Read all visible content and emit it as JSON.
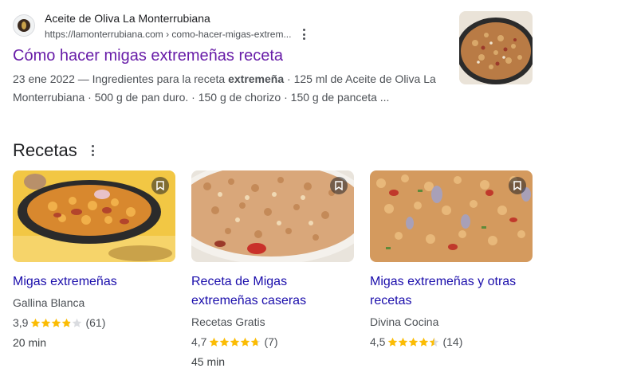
{
  "result": {
    "site_name": "Aceite de Oliva La Monterrubiana",
    "url": "https://lamonterrubiana.com › como-hacer-migas-extrem...",
    "title": "Cómo hacer migas extremeñas receta",
    "snippet_pre": "23 ene 2022 — Ingredientes para la receta ",
    "snippet_bold": "extremeña",
    "snippet_post": " · 125 ml de Aceite de Oliva La Monterrubiana · 500 g de pan duro. · 150 g de chorizo · 150 g de panceta ..."
  },
  "recipes": {
    "heading": "Recetas",
    "cards": [
      {
        "title": "Migas extremeñas",
        "source": "Gallina Blanca",
        "rating": "3,9",
        "rating_value": 3.9,
        "count": "(61)",
        "time": "20 min",
        "image": "pan-of-migas-photo"
      },
      {
        "title": "Receta de Migas extremeñas caseras",
        "source": "Recetas Gratis",
        "rating": "4,7",
        "rating_value": 4.7,
        "count": "(7)",
        "time": "45 min",
        "image": "plate-of-migas-photo"
      },
      {
        "title": "Migas extremeñas y otras recetas",
        "source": "Divina Cocina",
        "rating": "4,5",
        "rating_value": 4.5,
        "count": "(14)",
        "time": "",
        "image": "migas-closeup-photo"
      }
    ]
  },
  "colors": {
    "link_visited": "#681da8",
    "link": "#1a0dab",
    "star": "#fbbc04",
    "star_empty": "#dadce0",
    "text_secondary": "#4d5156"
  }
}
